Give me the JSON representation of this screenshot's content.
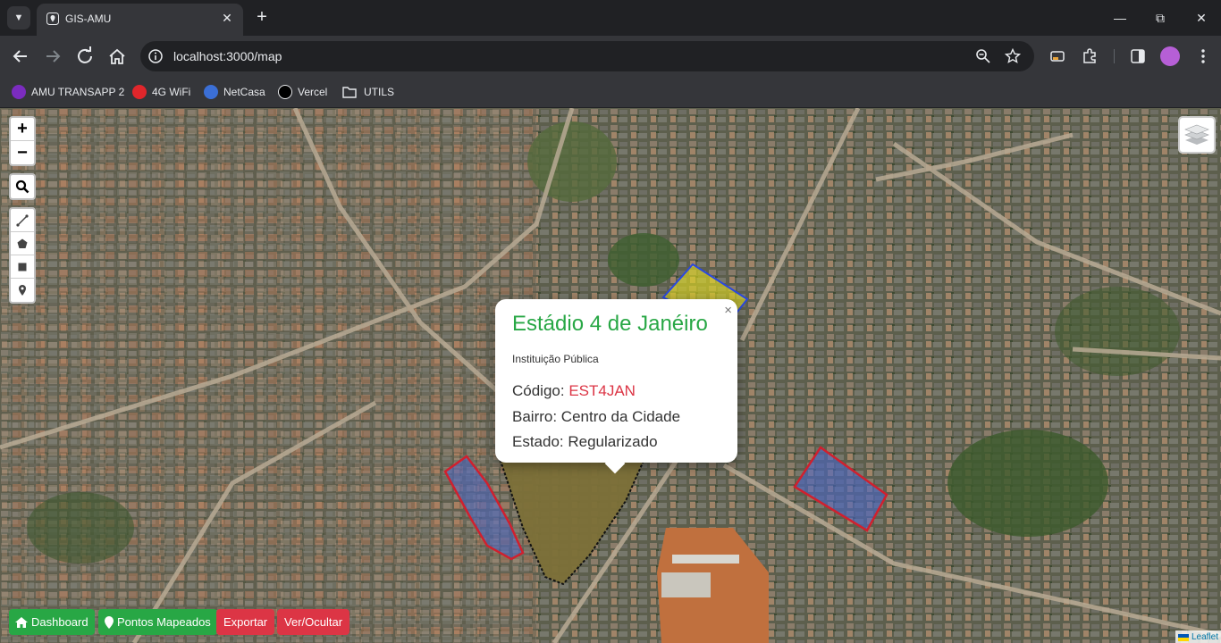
{
  "browser": {
    "tab_title": "GIS-AMU",
    "url": "localhost:3000/map",
    "bookmarks": [
      {
        "label": "AMU TRANSAPP 2",
        "icon": "transapp-icon",
        "color": "#7b2cbf"
      },
      {
        "label": "4G WiFi",
        "icon": "huawei-icon",
        "color": "#e0262b"
      },
      {
        "label": "NetCasa",
        "icon": "netcasa-icon",
        "color": "#3b6fd6"
      },
      {
        "label": "Vercel",
        "icon": "vercel-icon",
        "color": "#000000"
      },
      {
        "label": "UTILS",
        "icon": "folder-icon",
        "color": "#e8eaed"
      }
    ]
  },
  "map": {
    "zoom_in": "+",
    "zoom_out": "−",
    "attribution": "Leaflet"
  },
  "popup": {
    "close": "×",
    "title": "Estádio 4 de Janéiro",
    "subtitle": "Instituição Pública",
    "code_label": "Código: ",
    "code_value": "EST4JAN",
    "bairro_line": "Bairro: Centro da Cidade",
    "estado_line": "Estado: Regularizado"
  },
  "buttons": {
    "dashboard": "Dashboard",
    "pontos": "Pontos Mapeados",
    "exportar": "Exportar",
    "ver_ocultar": "Ver/Ocultar"
  },
  "colors": {
    "green": "#28a745",
    "red": "#dc3545"
  }
}
